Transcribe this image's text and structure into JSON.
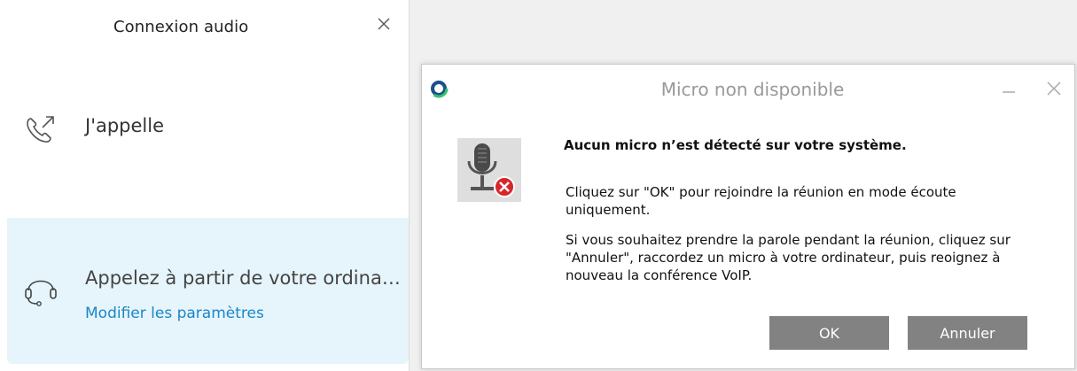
{
  "panel": {
    "title": "Connexion audio",
    "call_label": "J'appelle",
    "computer_label": "Appelez à partir de votre ordinateur",
    "settings_link": "Modifier les paramètres",
    "highlight_color": "#e6f5fb",
    "link_color": "#1a86c8"
  },
  "dialog": {
    "title": "Micro non disponible",
    "heading": "Aucun micro n’est détecté sur votre système.",
    "paragraph1": "Cliquez sur \"OK\" pour rejoindre la réunion en mode écoute uniquement.",
    "paragraph2": "Si vous souhaitez prendre la parole pendant la réunion, cliquez sur \"Annuler\", raccordez un micro à votre ordinateur, puis reoignez à nouveau la conférence VoIP.",
    "ok_label": "OK",
    "cancel_label": "Annuler",
    "button_color": "#828282"
  },
  "icons": {
    "panel_close": "close-icon",
    "call": "phone-outgoing-icon",
    "computer": "headset-icon",
    "app": "app-logo-icon",
    "minimize": "minimize-icon",
    "dialog_close": "close-icon",
    "mic": "microphone-error-icon"
  }
}
